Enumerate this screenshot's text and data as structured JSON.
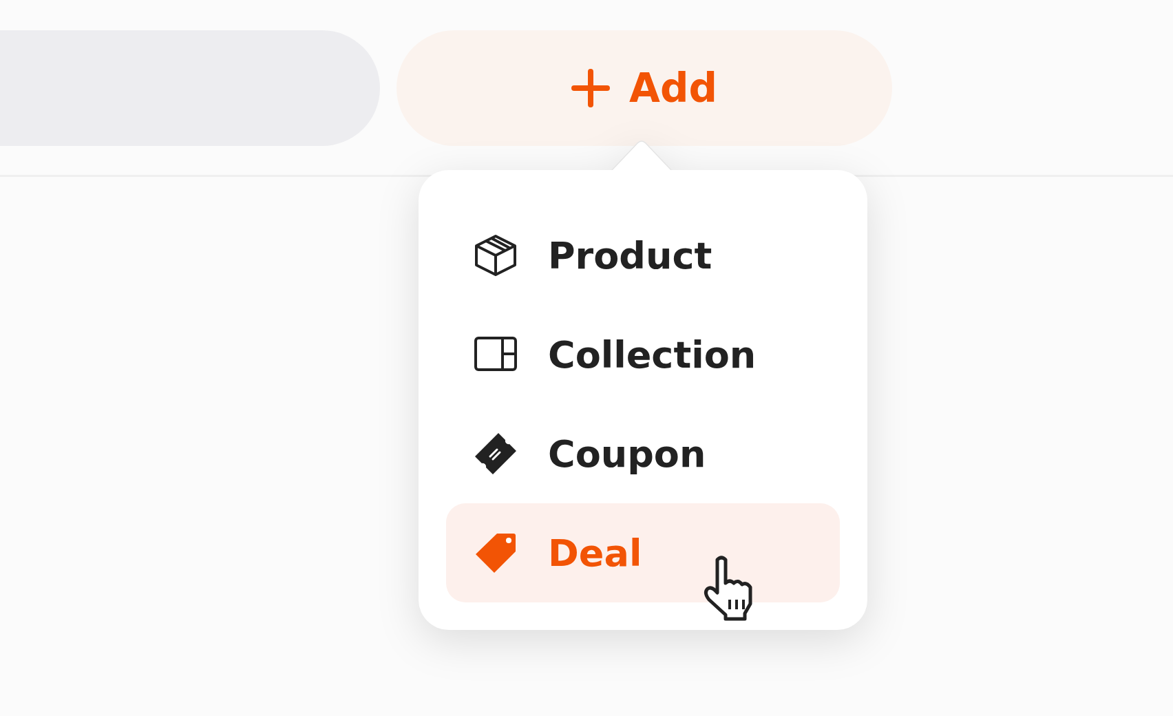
{
  "add_button": {
    "label": "Add"
  },
  "menu": {
    "items": [
      {
        "label": "Product",
        "kind": "product",
        "selected": false
      },
      {
        "label": "Collection",
        "kind": "collection",
        "selected": false
      },
      {
        "label": "Coupon",
        "kind": "coupon",
        "selected": false
      },
      {
        "label": "Deal",
        "kind": "deal",
        "selected": true
      }
    ]
  }
}
